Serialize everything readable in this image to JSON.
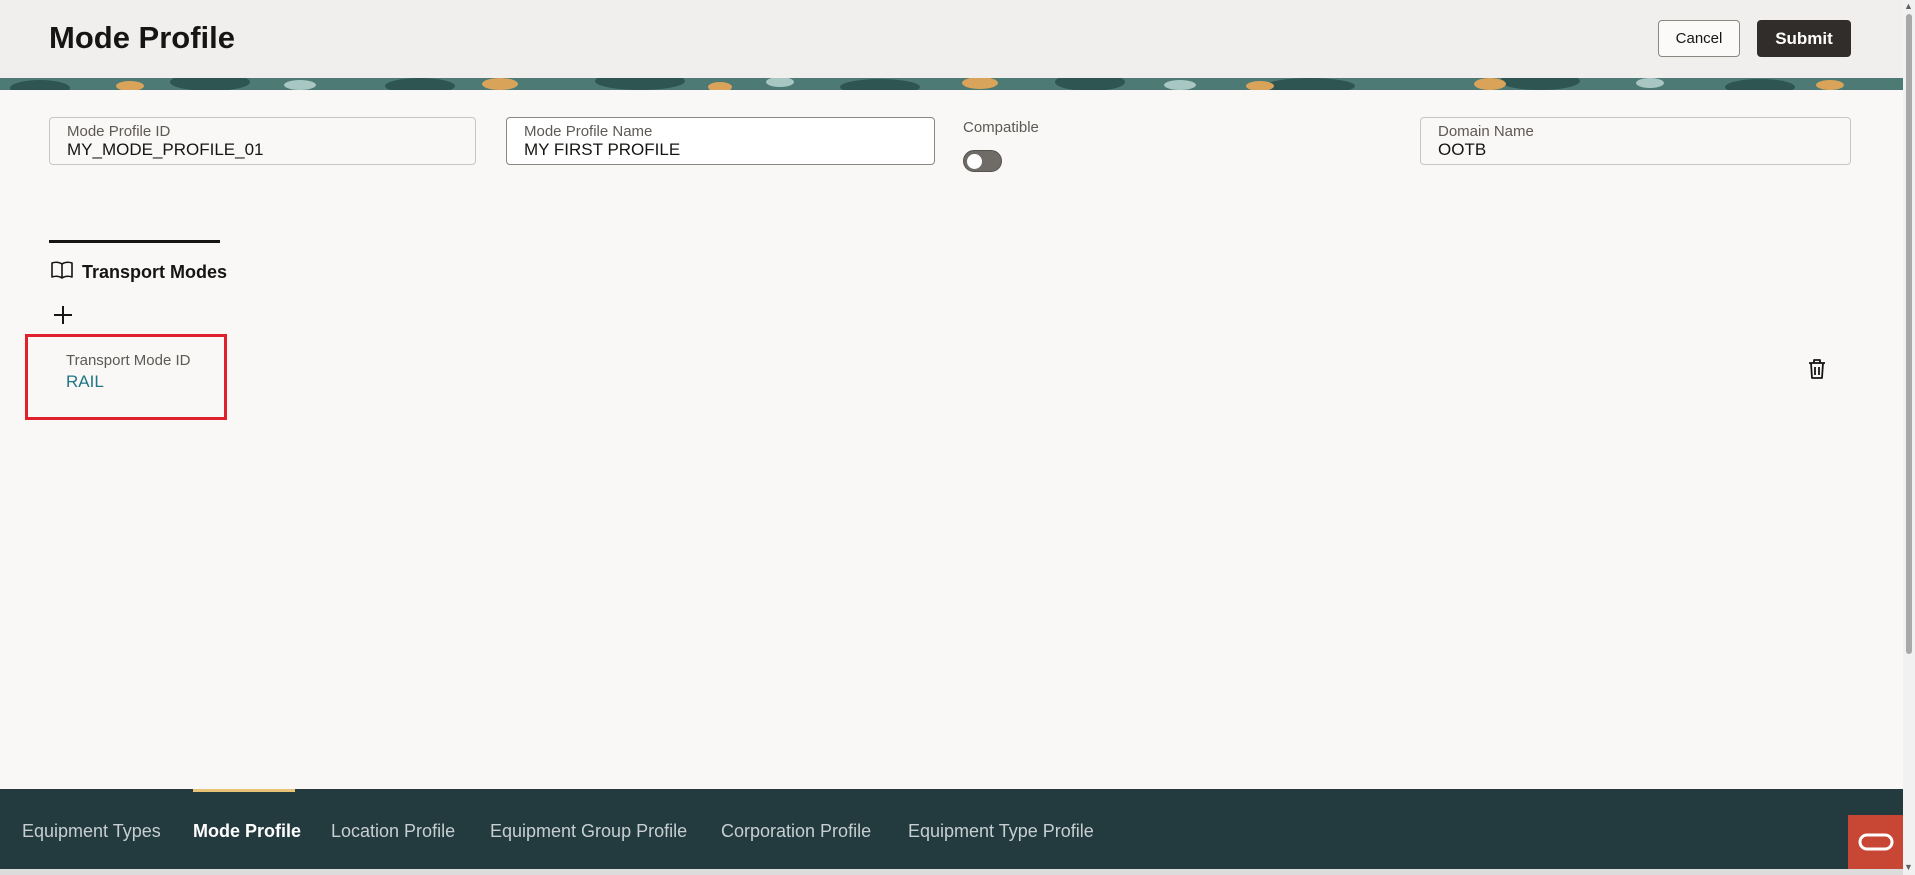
{
  "header": {
    "title": "Mode Profile",
    "cancel_label": "Cancel",
    "submit_label": "Submit"
  },
  "fields": {
    "mode_profile_id": {
      "label": "Mode Profile ID",
      "value": "MY_MODE_PROFILE_01"
    },
    "mode_profile_name": {
      "label": "Mode Profile Name",
      "value": "MY FIRST PROFILE"
    },
    "compatible": {
      "label": "Compatible",
      "checked": false
    },
    "domain_name": {
      "label": "Domain Name",
      "value": "OOTB"
    }
  },
  "transport_modes": {
    "title": "Transport Modes",
    "rows": [
      {
        "label": "Transport Mode ID",
        "value": "RAIL"
      }
    ]
  },
  "bottom_nav": {
    "tabs": [
      {
        "label": "Equipment Types",
        "active": false
      },
      {
        "label": "Mode Profile",
        "active": true
      },
      {
        "label": "Location Profile",
        "active": false
      },
      {
        "label": "Equipment Group Profile",
        "active": false
      },
      {
        "label": "Corporation Profile",
        "active": false
      },
      {
        "label": "Equipment Type Profile",
        "active": false
      }
    ]
  },
  "colors": {
    "accent_dark": "#312d2a",
    "nav_bg": "#233a3f",
    "link": "#227585",
    "highlight": "#e0212b",
    "oracle_red": "#c74634"
  },
  "icons": [
    "book-icon",
    "plus-icon",
    "trash-icon",
    "oracle-logo-icon"
  ]
}
